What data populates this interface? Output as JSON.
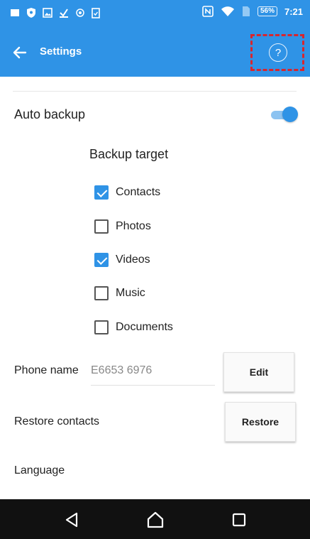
{
  "status_bar": {
    "battery": "56%",
    "time": "7:21",
    "left_icons": [
      "notification-icon",
      "shield-icon",
      "image-icon",
      "download-icon",
      "record-icon",
      "clipboard-icon"
    ],
    "right_icons": [
      "nfc-icon",
      "wifi-icon",
      "sim-icon",
      "battery-icon"
    ]
  },
  "app_bar": {
    "title": "Settings",
    "back_icon": "arrow-left-icon",
    "help_symbol": "?",
    "color": "#2f93e6"
  },
  "settings": {
    "auto_backup": {
      "label": "Auto backup",
      "enabled": true
    },
    "backup_target": {
      "heading": "Backup target",
      "items": [
        {
          "label": "Contacts",
          "checked": true
        },
        {
          "label": "Photos",
          "checked": false
        },
        {
          "label": "Videos",
          "checked": true
        },
        {
          "label": "Music",
          "checked": false
        },
        {
          "label": "Documents",
          "checked": false
        }
      ]
    },
    "phone_name": {
      "label": "Phone name",
      "value": "E6653 6976",
      "button": "Edit"
    },
    "restore_contacts": {
      "label": "Restore contacts",
      "button": "Restore"
    },
    "language": {
      "label": "Language"
    }
  },
  "nav_bar": {
    "icons": [
      "back-triangle-icon",
      "home-icon",
      "recent-apps-icon"
    ]
  },
  "highlight_color": "#d8262e"
}
